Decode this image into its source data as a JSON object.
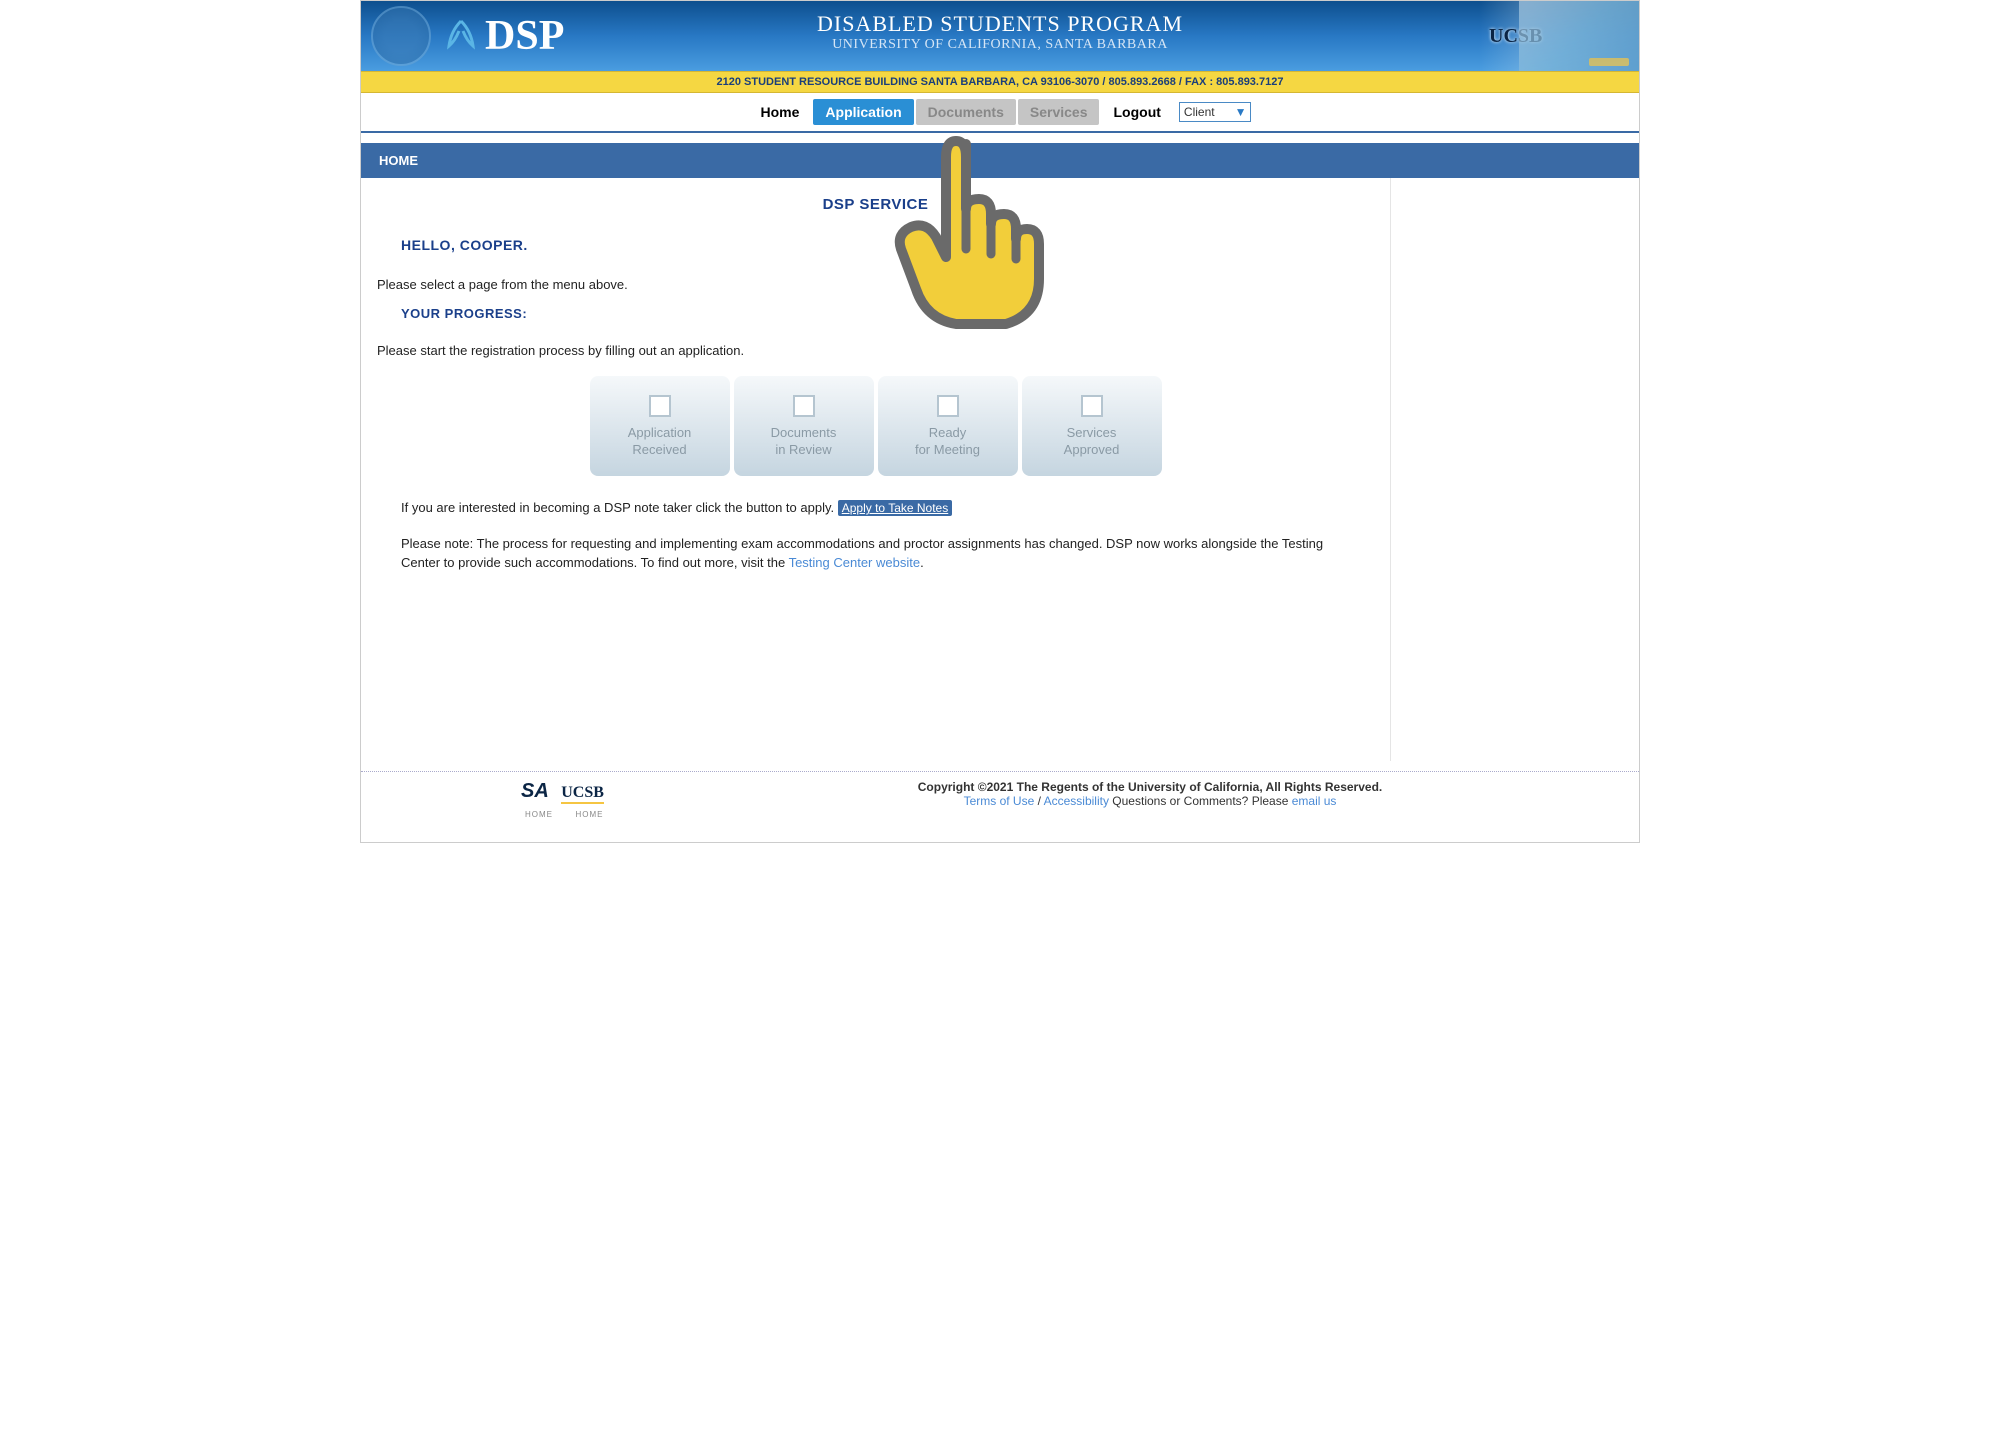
{
  "banner": {
    "logo_text": "DSP",
    "title": "DISABLED STUDENTS PROGRAM",
    "subtitle": "UNIVERSITY OF CALIFORNIA, SANTA BARBARA",
    "ucsb": "UCSB"
  },
  "address": "2120 STUDENT RESOURCE BUILDING SANTA BARBARA, CA 93106-3070 / 805.893.2668 / FAX : 805.893.7127",
  "nav": {
    "home": "Home",
    "application": "Application",
    "documents": "Documents",
    "services": "Services",
    "logout": "Logout",
    "role": "Client"
  },
  "section": "HOME",
  "panel": {
    "title": "DSP SERVICE",
    "hello": "HELLO, COOPER.",
    "instruction": "Please select a page from the menu above.",
    "progress_heading": "YOUR PROGRESS:",
    "start_text": "Please start the registration process by filling out an application.",
    "cards": [
      {
        "l1": "Application",
        "l2": "Received"
      },
      {
        "l1": "Documents",
        "l2": "in Review"
      },
      {
        "l1": "Ready",
        "l2": "for Meeting"
      },
      {
        "l1": "Services",
        "l2": "Approved"
      }
    ],
    "notetaker_pre": "If you are interested in becoming a DSP note taker click the button to apply. ",
    "notetaker_btn": "Apply to Take Notes",
    "exam_note_pre": "Please note: The process for requesting and implementing exam accommodations and proctor assignments has changed. DSP now works alongside the Testing Center to provide such accommodations. To find out more, visit the ",
    "exam_note_link": "Testing Center website",
    "exam_note_post": "."
  },
  "footer": {
    "sa": "SA",
    "sa_sub": "HOME",
    "ucsb": "UCSB",
    "ucsb_sub": "HOME",
    "copyright": "Copyright ©2021 The Regents of the University of California, All Rights Reserved.",
    "terms": "Terms of Use",
    "sep1": " / ",
    "accessibility": "Accessibility",
    "q_pre": "  Questions or Comments? Please ",
    "email": "email us"
  }
}
